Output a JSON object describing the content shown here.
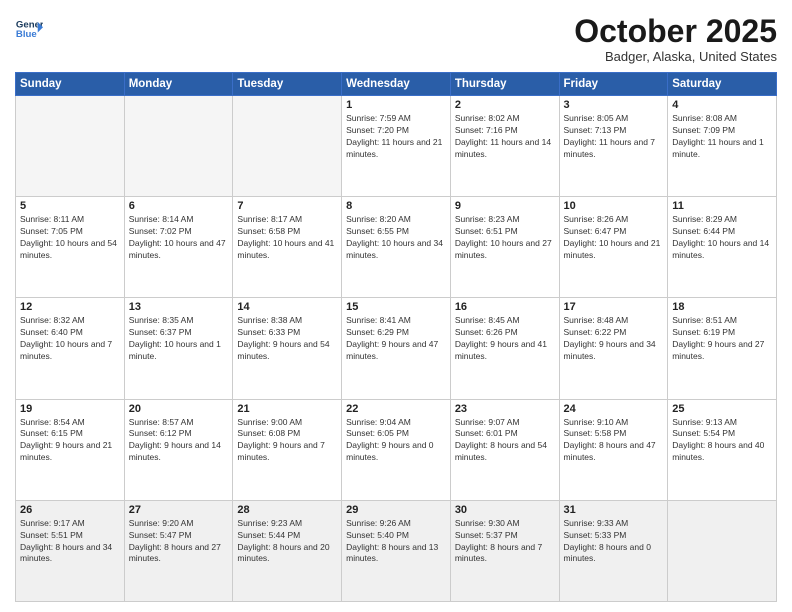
{
  "header": {
    "logo_line1": "General",
    "logo_line2": "Blue",
    "month": "October 2025",
    "location": "Badger, Alaska, United States"
  },
  "days_of_week": [
    "Sunday",
    "Monday",
    "Tuesday",
    "Wednesday",
    "Thursday",
    "Friday",
    "Saturday"
  ],
  "weeks": [
    [
      {
        "day": "",
        "sunrise": "",
        "sunset": "",
        "daylight": ""
      },
      {
        "day": "",
        "sunrise": "",
        "sunset": "",
        "daylight": ""
      },
      {
        "day": "",
        "sunrise": "",
        "sunset": "",
        "daylight": ""
      },
      {
        "day": "1",
        "sunrise": "Sunrise: 7:59 AM",
        "sunset": "Sunset: 7:20 PM",
        "daylight": "Daylight: 11 hours and 21 minutes."
      },
      {
        "day": "2",
        "sunrise": "Sunrise: 8:02 AM",
        "sunset": "Sunset: 7:16 PM",
        "daylight": "Daylight: 11 hours and 14 minutes."
      },
      {
        "day": "3",
        "sunrise": "Sunrise: 8:05 AM",
        "sunset": "Sunset: 7:13 PM",
        "daylight": "Daylight: 11 hours and 7 minutes."
      },
      {
        "day": "4",
        "sunrise": "Sunrise: 8:08 AM",
        "sunset": "Sunset: 7:09 PM",
        "daylight": "Daylight: 11 hours and 1 minute."
      }
    ],
    [
      {
        "day": "5",
        "sunrise": "Sunrise: 8:11 AM",
        "sunset": "Sunset: 7:05 PM",
        "daylight": "Daylight: 10 hours and 54 minutes."
      },
      {
        "day": "6",
        "sunrise": "Sunrise: 8:14 AM",
        "sunset": "Sunset: 7:02 PM",
        "daylight": "Daylight: 10 hours and 47 minutes."
      },
      {
        "day": "7",
        "sunrise": "Sunrise: 8:17 AM",
        "sunset": "Sunset: 6:58 PM",
        "daylight": "Daylight: 10 hours and 41 minutes."
      },
      {
        "day": "8",
        "sunrise": "Sunrise: 8:20 AM",
        "sunset": "Sunset: 6:55 PM",
        "daylight": "Daylight: 10 hours and 34 minutes."
      },
      {
        "day": "9",
        "sunrise": "Sunrise: 8:23 AM",
        "sunset": "Sunset: 6:51 PM",
        "daylight": "Daylight: 10 hours and 27 minutes."
      },
      {
        "day": "10",
        "sunrise": "Sunrise: 8:26 AM",
        "sunset": "Sunset: 6:47 PM",
        "daylight": "Daylight: 10 hours and 21 minutes."
      },
      {
        "day": "11",
        "sunrise": "Sunrise: 8:29 AM",
        "sunset": "Sunset: 6:44 PM",
        "daylight": "Daylight: 10 hours and 14 minutes."
      }
    ],
    [
      {
        "day": "12",
        "sunrise": "Sunrise: 8:32 AM",
        "sunset": "Sunset: 6:40 PM",
        "daylight": "Daylight: 10 hours and 7 minutes."
      },
      {
        "day": "13",
        "sunrise": "Sunrise: 8:35 AM",
        "sunset": "Sunset: 6:37 PM",
        "daylight": "Daylight: 10 hours and 1 minute."
      },
      {
        "day": "14",
        "sunrise": "Sunrise: 8:38 AM",
        "sunset": "Sunset: 6:33 PM",
        "daylight": "Daylight: 9 hours and 54 minutes."
      },
      {
        "day": "15",
        "sunrise": "Sunrise: 8:41 AM",
        "sunset": "Sunset: 6:29 PM",
        "daylight": "Daylight: 9 hours and 47 minutes."
      },
      {
        "day": "16",
        "sunrise": "Sunrise: 8:45 AM",
        "sunset": "Sunset: 6:26 PM",
        "daylight": "Daylight: 9 hours and 41 minutes."
      },
      {
        "day": "17",
        "sunrise": "Sunrise: 8:48 AM",
        "sunset": "Sunset: 6:22 PM",
        "daylight": "Daylight: 9 hours and 34 minutes."
      },
      {
        "day": "18",
        "sunrise": "Sunrise: 8:51 AM",
        "sunset": "Sunset: 6:19 PM",
        "daylight": "Daylight: 9 hours and 27 minutes."
      }
    ],
    [
      {
        "day": "19",
        "sunrise": "Sunrise: 8:54 AM",
        "sunset": "Sunset: 6:15 PM",
        "daylight": "Daylight: 9 hours and 21 minutes."
      },
      {
        "day": "20",
        "sunrise": "Sunrise: 8:57 AM",
        "sunset": "Sunset: 6:12 PM",
        "daylight": "Daylight: 9 hours and 14 minutes."
      },
      {
        "day": "21",
        "sunrise": "Sunrise: 9:00 AM",
        "sunset": "Sunset: 6:08 PM",
        "daylight": "Daylight: 9 hours and 7 minutes."
      },
      {
        "day": "22",
        "sunrise": "Sunrise: 9:04 AM",
        "sunset": "Sunset: 6:05 PM",
        "daylight": "Daylight: 9 hours and 0 minutes."
      },
      {
        "day": "23",
        "sunrise": "Sunrise: 9:07 AM",
        "sunset": "Sunset: 6:01 PM",
        "daylight": "Daylight: 8 hours and 54 minutes."
      },
      {
        "day": "24",
        "sunrise": "Sunrise: 9:10 AM",
        "sunset": "Sunset: 5:58 PM",
        "daylight": "Daylight: 8 hours and 47 minutes."
      },
      {
        "day": "25",
        "sunrise": "Sunrise: 9:13 AM",
        "sunset": "Sunset: 5:54 PM",
        "daylight": "Daylight: 8 hours and 40 minutes."
      }
    ],
    [
      {
        "day": "26",
        "sunrise": "Sunrise: 9:17 AM",
        "sunset": "Sunset: 5:51 PM",
        "daylight": "Daylight: 8 hours and 34 minutes."
      },
      {
        "day": "27",
        "sunrise": "Sunrise: 9:20 AM",
        "sunset": "Sunset: 5:47 PM",
        "daylight": "Daylight: 8 hours and 27 minutes."
      },
      {
        "day": "28",
        "sunrise": "Sunrise: 9:23 AM",
        "sunset": "Sunset: 5:44 PM",
        "daylight": "Daylight: 8 hours and 20 minutes."
      },
      {
        "day": "29",
        "sunrise": "Sunrise: 9:26 AM",
        "sunset": "Sunset: 5:40 PM",
        "daylight": "Daylight: 8 hours and 13 minutes."
      },
      {
        "day": "30",
        "sunrise": "Sunrise: 9:30 AM",
        "sunset": "Sunset: 5:37 PM",
        "daylight": "Daylight: 8 hours and 7 minutes."
      },
      {
        "day": "31",
        "sunrise": "Sunrise: 9:33 AM",
        "sunset": "Sunset: 5:33 PM",
        "daylight": "Daylight: 8 hours and 0 minutes."
      },
      {
        "day": "",
        "sunrise": "",
        "sunset": "",
        "daylight": ""
      }
    ]
  ]
}
